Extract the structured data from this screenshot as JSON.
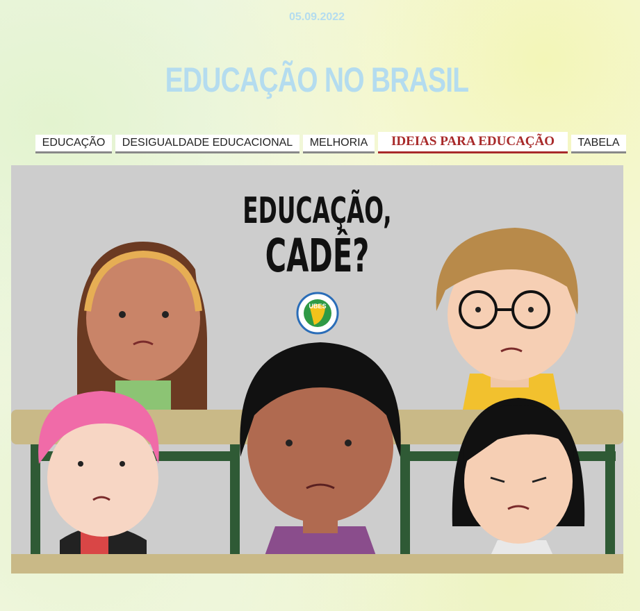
{
  "header": {
    "date": "05.09.2022",
    "title": "EDUCAÇÃO NO BRASIL"
  },
  "nav": {
    "tabs": [
      {
        "label": "EDUCAÇÃO",
        "active": false
      },
      {
        "label": "DESIGUALDADE EDUCACIONAL",
        "active": false
      },
      {
        "label": "MELHORIA",
        "active": false
      },
      {
        "label": "IDEIAS PARA EDUCAÇÃO",
        "active": true
      },
      {
        "label": "TABELA",
        "active": false
      }
    ]
  },
  "banner": {
    "headline_line1": "EDUCAÇÃO,",
    "headline_line2": "CADÊ?",
    "logo_text": "UBES"
  },
  "colors": {
    "title_blue": "#b4dcef",
    "active_tab": "#a82a2a",
    "banner_bg": "#cdcdcd",
    "desk": "#c9b987",
    "desk_legs": "#2f5a35"
  }
}
